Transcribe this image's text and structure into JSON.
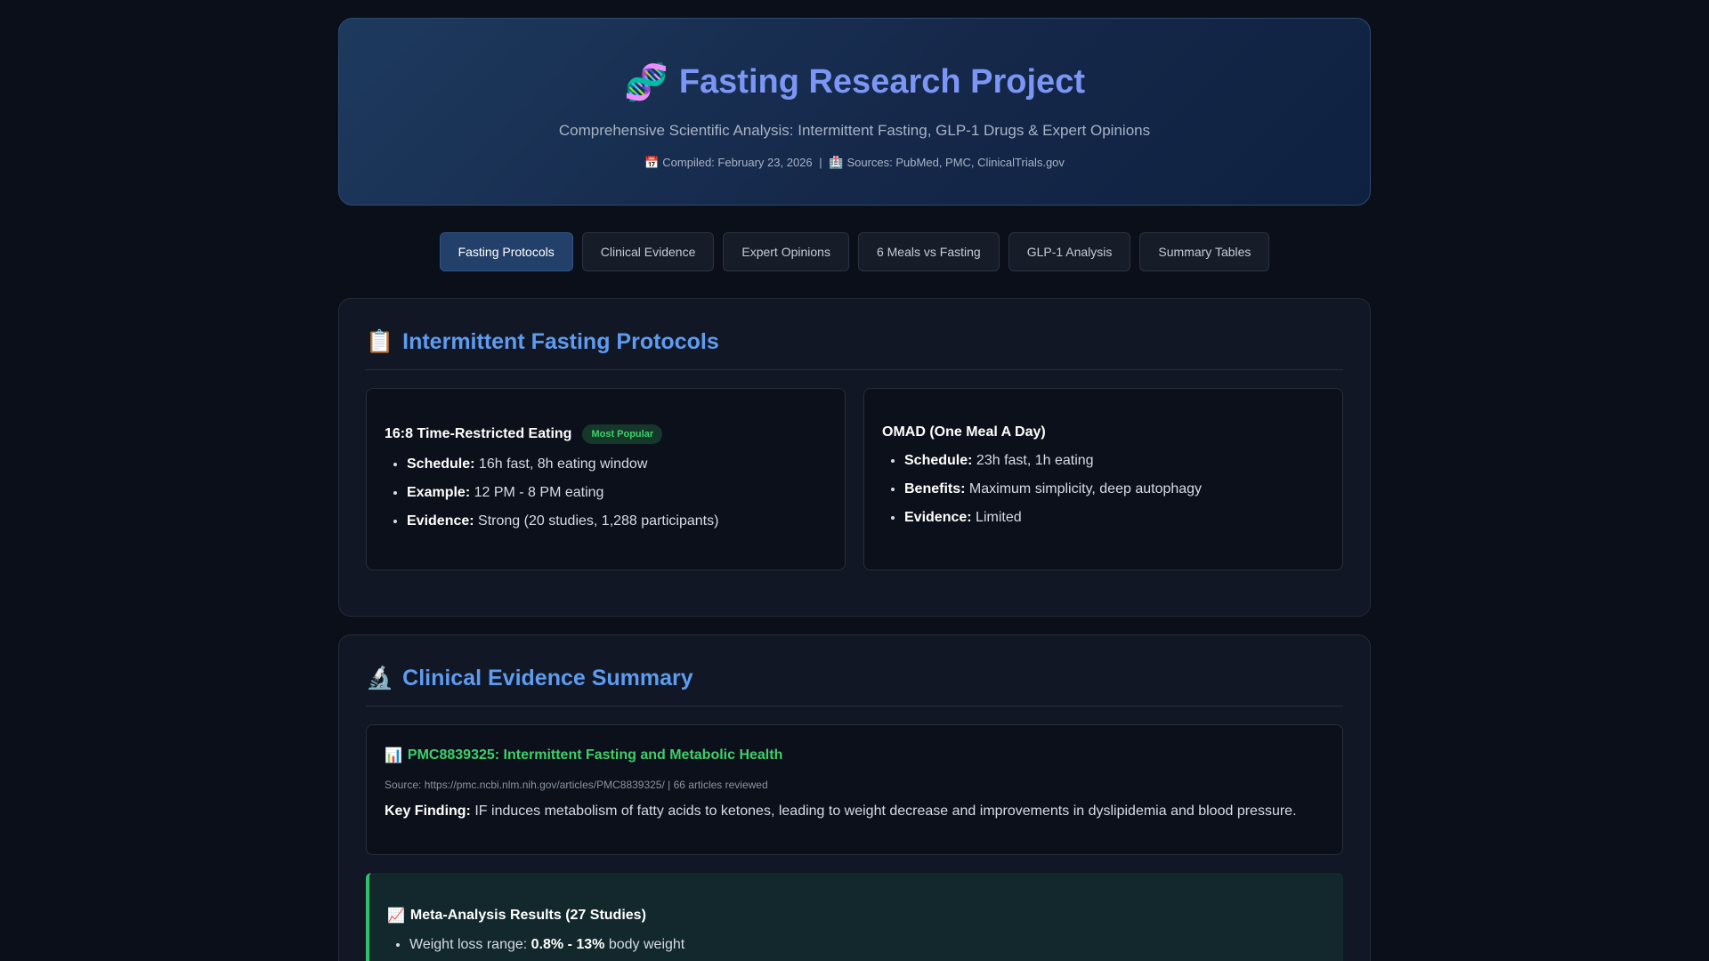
{
  "header": {
    "icon": "dna-icon",
    "title": "Fasting Research Project",
    "subtitle": "Comprehensive Scientific Analysis: Intermittent Fasting, GLP-1 Drugs & Expert Opinions",
    "compiled": "Compiled: February 23, 2026",
    "separator": "|",
    "sources": "Sources: PubMed, PMC, ClinicalTrials.gov"
  },
  "tabs": [
    {
      "label": "Fasting Protocols",
      "active": true
    },
    {
      "label": "Clinical Evidence",
      "active": false
    },
    {
      "label": "Expert Opinions",
      "active": false
    },
    {
      "label": "6 Meals vs Fasting",
      "active": false
    },
    {
      "label": "GLP-1 Analysis",
      "active": false
    },
    {
      "label": "Summary Tables",
      "active": false
    }
  ],
  "protocols": {
    "icon": "clipboard-icon",
    "title": "Intermittent Fasting Protocols",
    "cards": [
      {
        "title": "16:8 Time-Restricted Eating",
        "badge": "Most Popular",
        "items": [
          {
            "label": "Schedule:",
            "value": "16h fast, 8h eating window"
          },
          {
            "label": "Example:",
            "value": "12 PM - 8 PM eating"
          },
          {
            "label": "Evidence:",
            "value": "Strong (20 studies, 1,288 participants)"
          }
        ]
      },
      {
        "title": "OMAD (One Meal A Day)",
        "items": [
          {
            "label": "Schedule:",
            "value": "23h fast, 1h eating"
          },
          {
            "label": "Benefits:",
            "value": "Maximum simplicity, deep autophagy"
          },
          {
            "label": "Evidence:",
            "value": "Limited"
          }
        ]
      }
    ]
  },
  "clinical": {
    "icon": "microscope-icon",
    "title": "Clinical Evidence Summary",
    "study": {
      "icon": "bar-chart-icon",
      "title": "PMC8839325: Intermittent Fasting and Metabolic Health",
      "source": "Source: https://pmc.ncbi.nlm.nih.gov/articles/PMC8839325/ | 66 articles reviewed",
      "finding_label": "Key Finding:",
      "finding": "IF induces metabolism of fatty acids to ketones, leading to weight decrease and improvements in dyslipidemia and blood pressure."
    },
    "meta": {
      "icon": "trend-chart-icon",
      "title": "Meta-Analysis Results (27 Studies)",
      "items": [
        {
          "prefix": "Weight loss range:",
          "bold": "0.8% - 13%",
          "suffix": "body weight"
        }
      ]
    }
  }
}
